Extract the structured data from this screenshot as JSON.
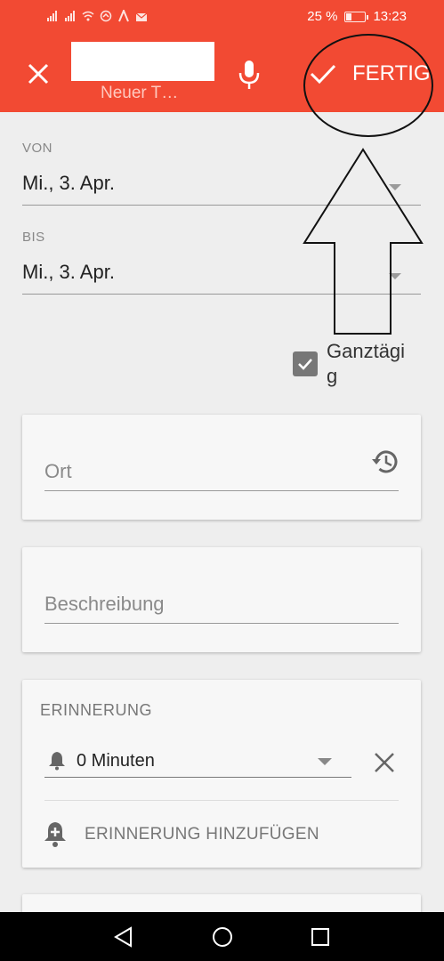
{
  "status_bar": {
    "battery_text": "25 %",
    "battery_level": 0.25,
    "time": "13:23"
  },
  "app_bar": {
    "title_placeholder": "Neuer T…",
    "done_label": "FERTIG",
    "close_icon": "close-icon",
    "mic_icon": "mic-icon",
    "done_icon": "check-icon"
  },
  "dates": {
    "from_label": "VON",
    "from_value": "Mi., 3. Apr.",
    "to_label": "BIS",
    "to_value": "Mi., 3. Apr."
  },
  "all_day": {
    "label": "Ganztägig",
    "checked": true
  },
  "location": {
    "placeholder": "Ort",
    "history_icon": "history-icon"
  },
  "description": {
    "placeholder": "Beschreibung"
  },
  "reminder": {
    "title": "ERINNERUNG",
    "value": "0 Minuten",
    "add_label": "ERINNERUNG HINZUFÜGEN"
  },
  "colors": {
    "accent": "#f24a33",
    "background": "#eeeeee",
    "card": "#f7f7f7"
  }
}
